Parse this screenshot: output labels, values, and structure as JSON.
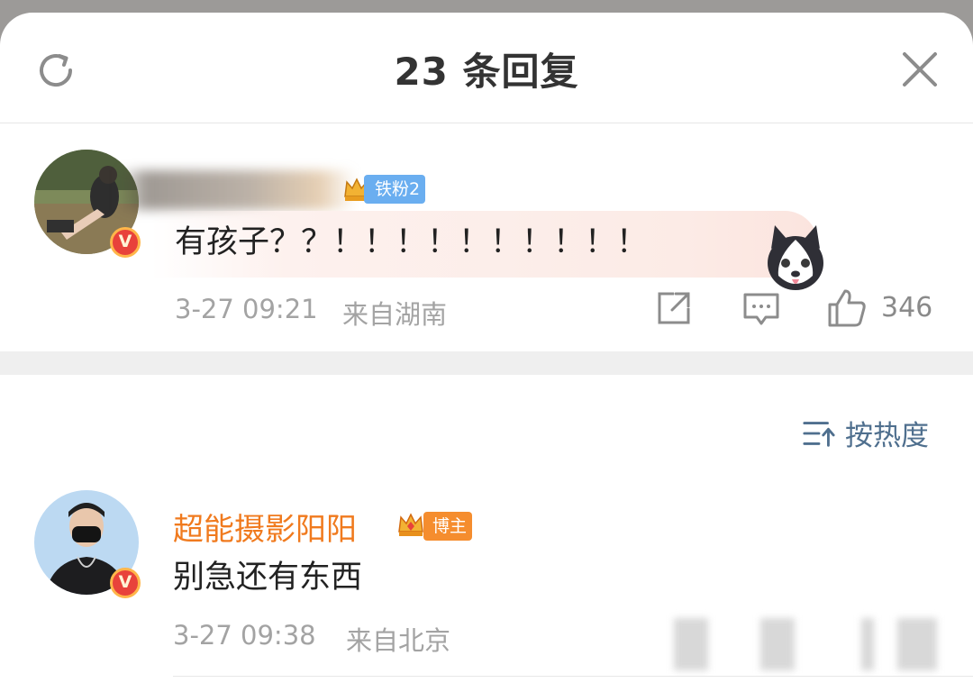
{
  "header": {
    "title": "23 条回复"
  },
  "main_comment": {
    "badge": "铁粉2",
    "text": "有孩子？？！！！！！！！！！！",
    "time": "3-27 09:21",
    "location": "来自湖南",
    "likes": "346",
    "verified_mark": "V"
  },
  "sort": {
    "label": "按热度"
  },
  "reply": {
    "username": "超能摄影阳阳",
    "badge": "博主",
    "text": "别急还有东西",
    "time": "3-27 09:38",
    "location": "来自北京",
    "verified_mark": "V"
  },
  "colors": {
    "username_orange": "#f07a1e",
    "sort_blue": "#4f6f8e",
    "fan_badge_blue": "#6aaef0",
    "blogger_badge_orange": "#f58d2e",
    "verified_red": "#e8423b"
  }
}
